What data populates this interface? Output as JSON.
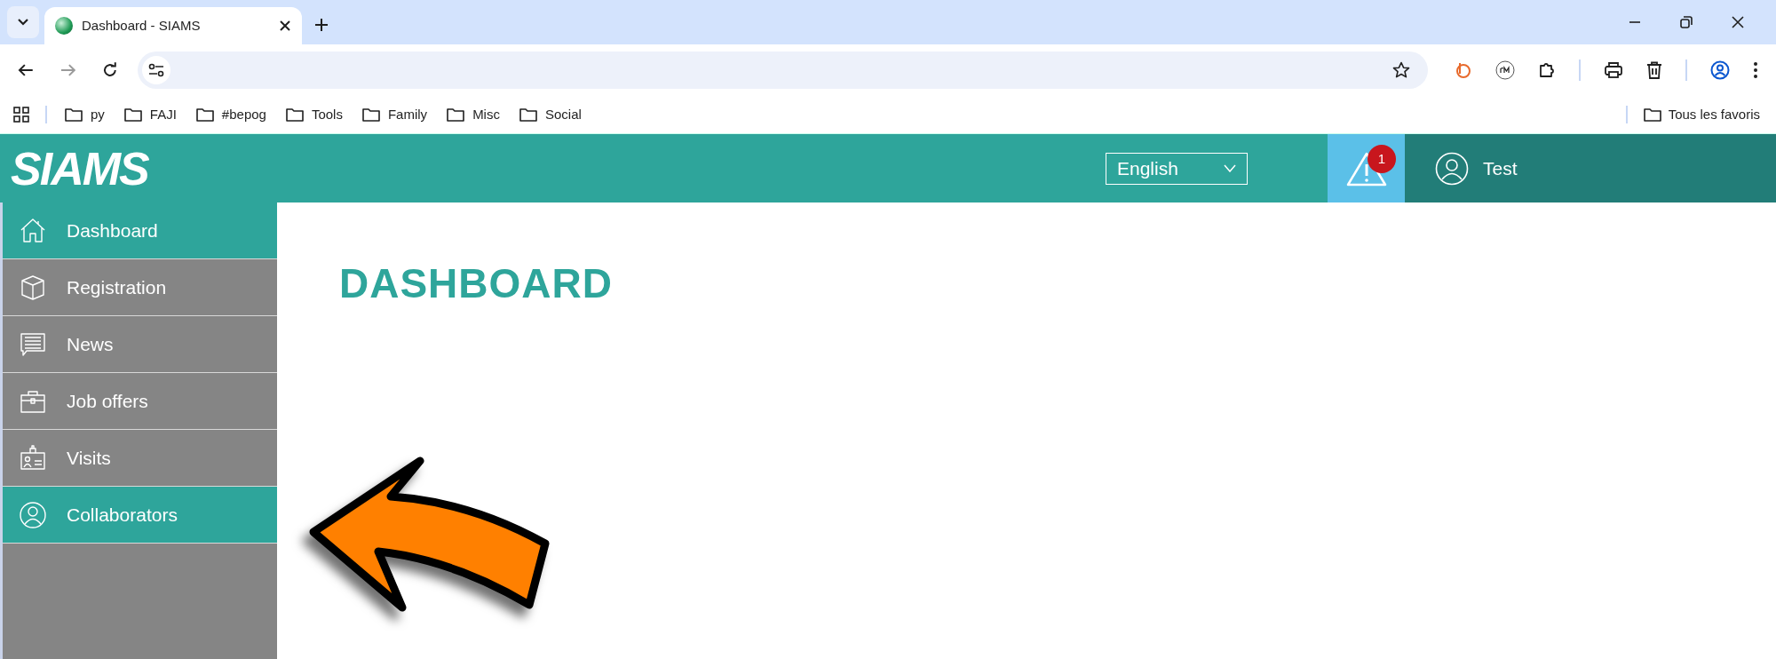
{
  "browser": {
    "tab": {
      "title": "Dashboard - SIAMS"
    },
    "bookmarks": [
      {
        "label": "py"
      },
      {
        "label": "FAJI"
      },
      {
        "label": "#bepog"
      },
      {
        "label": "Tools"
      },
      {
        "label": "Family"
      },
      {
        "label": "Misc"
      },
      {
        "label": "Social"
      }
    ],
    "all_bookmarks": "Tous les favoris"
  },
  "app": {
    "logo": "SIAMS",
    "language": "English",
    "alerts_count": "1",
    "user": "Test"
  },
  "sidebar": {
    "items": [
      {
        "label": "Dashboard",
        "kind": "house",
        "selected": true
      },
      {
        "label": "Registration",
        "kind": "box",
        "selected": false
      },
      {
        "label": "News",
        "kind": "message",
        "selected": false
      },
      {
        "label": "Job offers",
        "kind": "briefcase",
        "selected": false
      },
      {
        "label": "Visits",
        "kind": "badge",
        "selected": false
      },
      {
        "label": "Collaborators",
        "kind": "person",
        "selected": true
      }
    ]
  },
  "page": {
    "title": "DASHBOARD"
  }
}
